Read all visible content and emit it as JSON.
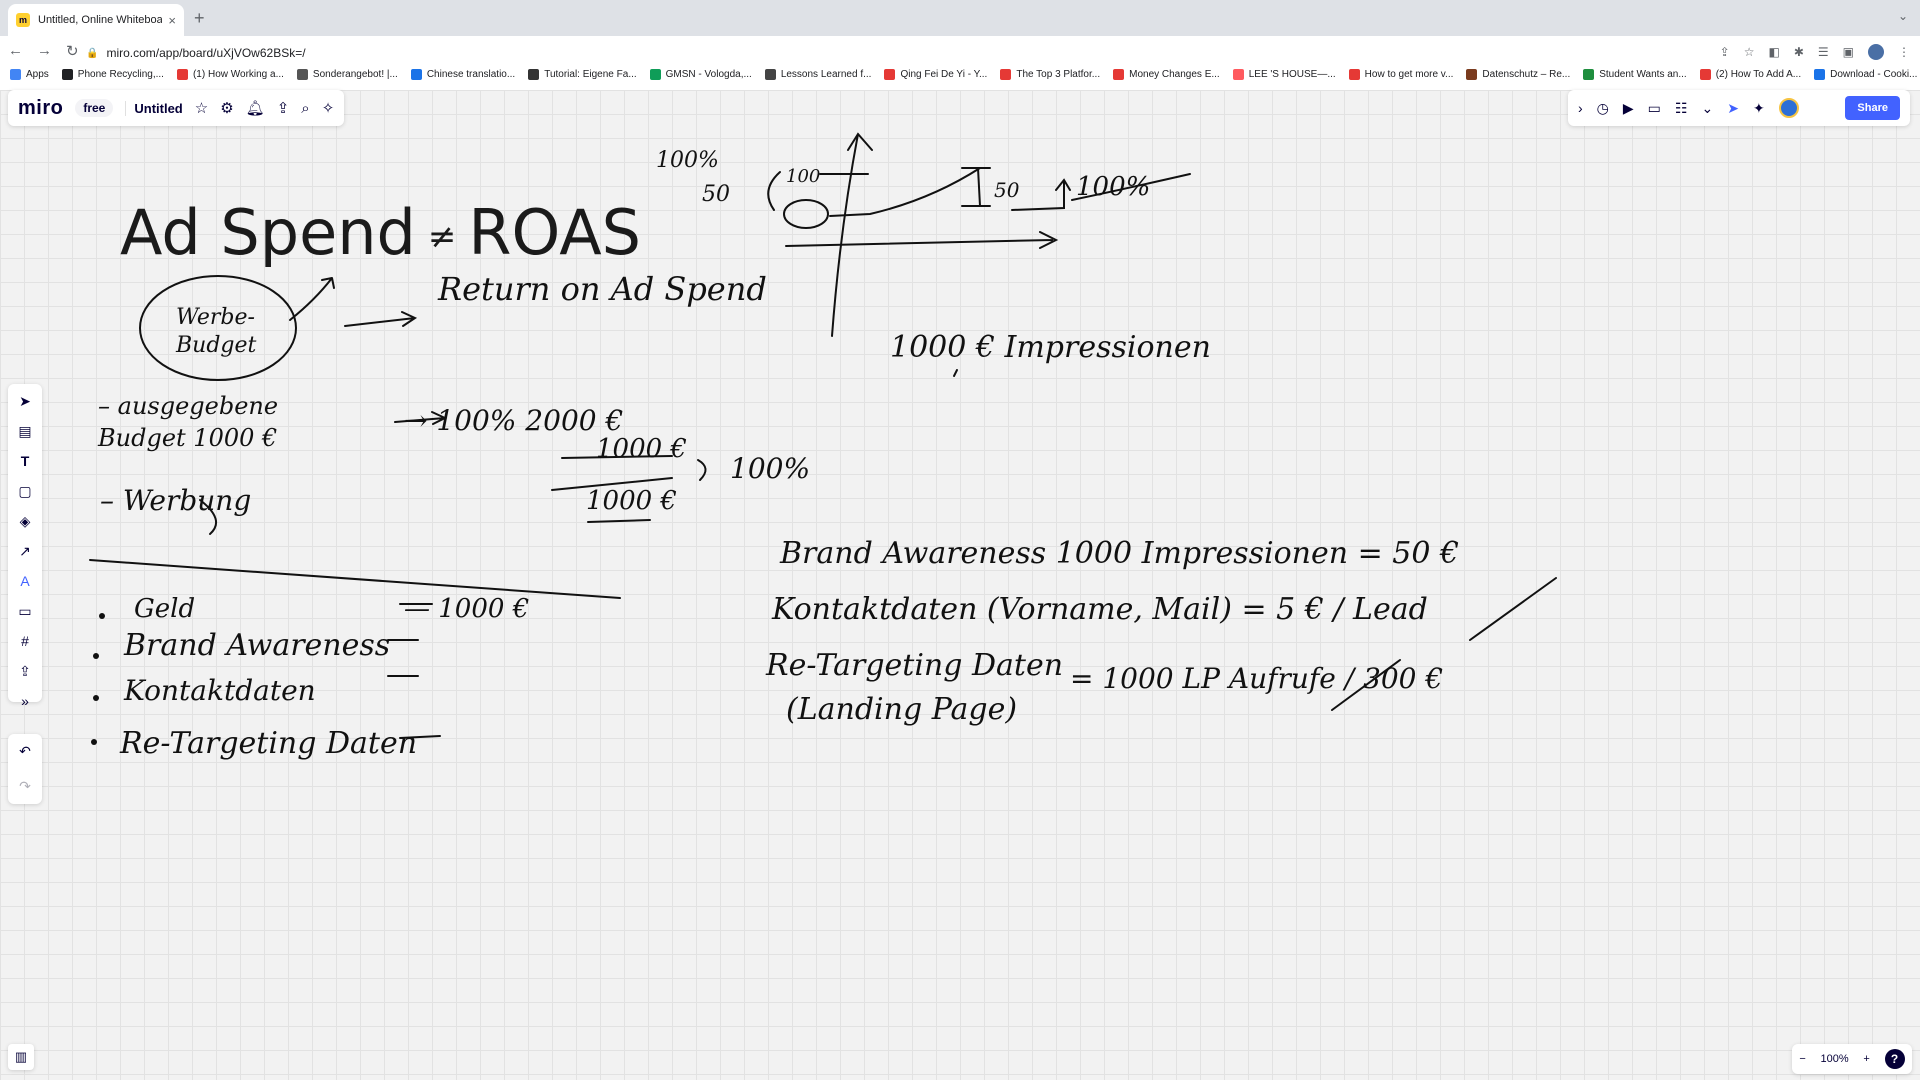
{
  "browser": {
    "tab_title": "Untitled, Online Whiteboard fo",
    "url": "miro.com/app/board/uXjVOw62BSk=/",
    "bookmarks": [
      "Apps",
      "Phone Recycling,...",
      "(1) How Working a...",
      "Sonderangebot! |...",
      "Chinese translatio...",
      "Tutorial: Eigene Fa...",
      "GMSN - Vologda,...",
      "Lessons Learned f...",
      "Qing Fei De Yi - Y...",
      "The Top 3 Platfor...",
      "Money Changes E...",
      "LEE 'S HOUSE—...",
      "How to get more v...",
      "Datenschutz – Re...",
      "Student Wants an...",
      "(2) How To Add A...",
      "Download - Cooki..."
    ]
  },
  "miro": {
    "logo": "miro",
    "plan": "free",
    "board_name": "Untitled",
    "share_label": "Share",
    "zoom": "100%",
    "help": "?"
  },
  "board": {
    "title_left": "Ad Spend",
    "title_sep": "≠",
    "title_right": "ROAS",
    "notes": {
      "budget_circle": "Werbe- Budget",
      "roas_full": "Return on Ad Spend",
      "ausgegeben": "– ausgegebene Budget 1000 €",
      "calc1": "→ 100% 2000 €",
      "calc2": "1000 €",
      "calc3": "1000 €",
      "calc_result": "100%",
      "werbung": "– Werbung",
      "chart_100pct": "100%",
      "chart_50": "50",
      "chart_100": "100",
      "chart_50b": "50",
      "chart_label": "100%",
      "impressions": "1000 € Impressionen",
      "list_geld": "Geld",
      "list_geld_val": "— 1000 €",
      "list_brand": "Brand Awareness",
      "list_kontakt": "Kontaktdaten",
      "list_retarget": "Re-Targeting Daten",
      "rhs_brand": "Brand Awareness  1000 Impressionen = 50 €",
      "rhs_kontakt": "Kontaktdaten (Vorname, Mail) = 5 € / Lead",
      "rhs_retarget": "Re-Targeting Daten",
      "rhs_retarget_val": "= 1000 LP Aufrufe / 300 €",
      "rhs_landing": "(Landing Page)"
    }
  },
  "colors": {
    "accent": "#4262ff",
    "miro_yellow": "#ffd02f",
    "ink": "#111111"
  }
}
